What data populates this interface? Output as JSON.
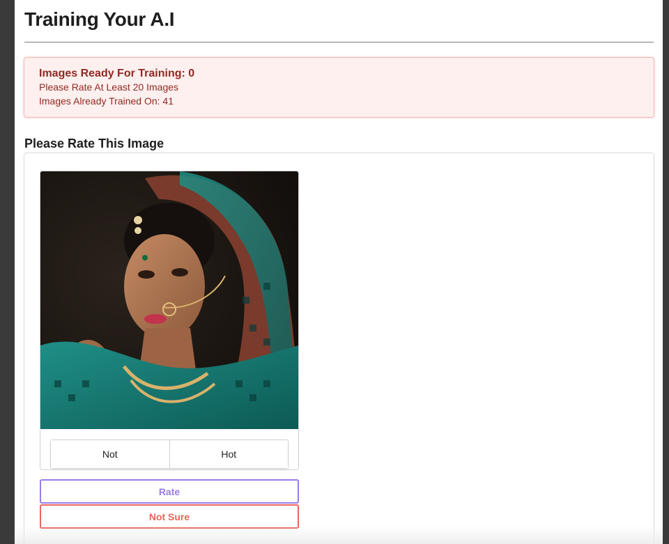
{
  "header": {
    "title": "Training Your A.I"
  },
  "alert": {
    "title": "Images Ready For Training: 0",
    "line1": "Please Rate At Least 20 Images",
    "line2": "Images Already Trained On: 41"
  },
  "rating": {
    "heading": "Please Rate This Image",
    "image_alt": "portrait photo to rate",
    "options": [
      "Not",
      "Hot"
    ],
    "rate_label": "Rate",
    "not_sure_label": "Not Sure"
  },
  "colors": {
    "alert_bg": "#fdf0ef",
    "alert_text": "#8f2a22",
    "rate_accent": "#9a7be8",
    "not_sure_accent": "#e8685c"
  }
}
